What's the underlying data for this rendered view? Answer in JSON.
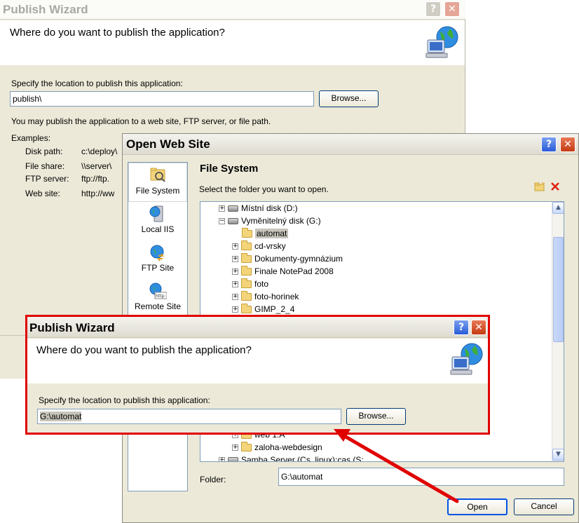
{
  "bg_wizard": {
    "title": "Publish Wizard",
    "header_title": "Where do you want to publish the application?",
    "location_label": "Specify the location to publish this application:",
    "location_value": "publish\\",
    "browse_label": "Browse...",
    "info_text": "You may publish the application to a web site, FTP server, or file path.",
    "examples_label": "Examples:",
    "examples": [
      {
        "label": "Disk path:",
        "value": "c:\\deploy\\"
      },
      {
        "label": "File share:",
        "value": "\\\\server\\"
      },
      {
        "label": "FTP server:",
        "value": "ftp://ftp."
      },
      {
        "label": "Web site:",
        "value": "http://ww"
      }
    ]
  },
  "open_web_site": {
    "title": "Open Web Site",
    "side_items": [
      {
        "label": "File System",
        "icon": "file-system-icon"
      },
      {
        "label": "Local IIS",
        "icon": "local-iis-icon"
      },
      {
        "label": "FTP Site",
        "icon": "ftp-site-icon"
      },
      {
        "label": "Remote Site",
        "icon": "remote-site-icon"
      }
    ],
    "section_title": "File System",
    "instruction": "Select the folder you want to open.",
    "tree": [
      {
        "label": "Místní disk (D:)",
        "type": "drive",
        "exp": "+"
      },
      {
        "label": "Vyměnitelný disk (G:)",
        "type": "drive",
        "exp": "−"
      },
      {
        "label": "automat",
        "type": "folder",
        "exp": ""
      },
      {
        "label": "cd-vrsky",
        "type": "folder",
        "exp": "+"
      },
      {
        "label": "Dokumenty-gymnázium",
        "type": "folder",
        "exp": "+"
      },
      {
        "label": "Finale NotePad 2008",
        "type": "folder",
        "exp": "+"
      },
      {
        "label": "foto",
        "type": "folder",
        "exp": "+"
      },
      {
        "label": "foto-horinek",
        "type": "folder",
        "exp": "+"
      },
      {
        "label": "GIMP_2_4",
        "type": "folder",
        "exp": "+"
      }
    ],
    "tree_bottom": [
      {
        "label": "web 1.A",
        "type": "folder",
        "exp": "+"
      },
      {
        "label": "zaloha-webdesign",
        "type": "folder",
        "exp": "+"
      },
      {
        "label": "Samba Server (Cs_linux):cas (S:",
        "type": "drive",
        "exp": "+"
      }
    ],
    "folder_label": "Folder:",
    "folder_value": "G:\\automat",
    "open_label": "Open",
    "cancel_label": "Cancel"
  },
  "front_wizard": {
    "title": "Publish Wizard",
    "header_title": "Where do you want to publish the application?",
    "location_label": "Specify the location to publish this application:",
    "location_value": "G:\\automat",
    "browse_label": "Browse..."
  },
  "titlebar_buttons": {
    "help": "?",
    "close": "✕"
  },
  "colors": {
    "highlight_border": "#e00000",
    "arrow": "#e00000",
    "xp_blue": "#0054e3"
  }
}
